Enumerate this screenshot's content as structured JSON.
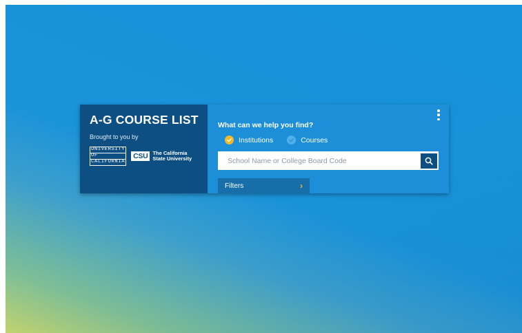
{
  "brand": {
    "title": "A-G COURSE LIST",
    "subtitle": "Brought to you by",
    "uc_logo": [
      "UNIVERSITY",
      "OF",
      "CALIFORNIA"
    ],
    "csu_mark": "CSU",
    "csu_name": [
      "The California",
      "State University"
    ]
  },
  "search": {
    "question": "What can we help you find?",
    "options": [
      {
        "label": "Institutions",
        "selected": true
      },
      {
        "label": "Courses",
        "selected": false
      }
    ],
    "placeholder": "School Name or College Board Code",
    "value": "",
    "filters_label": "Filters",
    "filters_chevron": "›"
  },
  "icons": {
    "menu": "kebab-menu-icon",
    "search": "search-icon",
    "selected": "check-icon"
  },
  "colors": {
    "brand_panel": "#0d4f82",
    "search_panel": "#1d8fd8",
    "accent": "#f5b927",
    "filters_bg": "#186ea9"
  }
}
